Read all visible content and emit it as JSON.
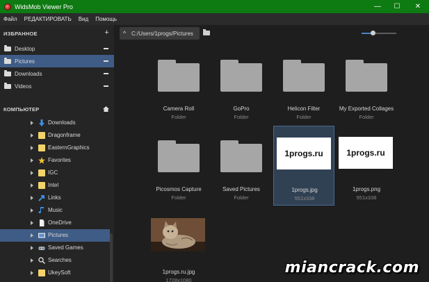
{
  "window": {
    "title": "WidsMob Viewer Pro",
    "minimize": "—",
    "maximize": "☐",
    "close": "✕"
  },
  "menu": [
    "Файл",
    "РЕДАКТИРОВАТЬ",
    "Вид",
    "Помощь"
  ],
  "sidebar": {
    "favorites_header": "ИЗБРАННОЕ",
    "favorites_add": "+",
    "favorites": [
      {
        "label": "Desktop",
        "selected": false
      },
      {
        "label": "Pictures",
        "selected": true
      },
      {
        "label": "Downloads",
        "selected": false
      },
      {
        "label": "Videos",
        "selected": false
      }
    ],
    "computer_header": "КОМПЬЮТЕР",
    "tree": [
      {
        "label": "Downloads",
        "icon": "download-arrow-icon"
      },
      {
        "label": "Dragonframe",
        "icon": "folder-icon"
      },
      {
        "label": "EasternGraphics",
        "icon": "folder-icon"
      },
      {
        "label": "Favorites",
        "icon": "star-icon"
      },
      {
        "label": "IGC",
        "icon": "folder-icon"
      },
      {
        "label": "Intel",
        "icon": "folder-icon"
      },
      {
        "label": "Links",
        "icon": "link-arrow-icon"
      },
      {
        "label": "Music",
        "icon": "music-note-icon"
      },
      {
        "label": "OneDrive",
        "icon": "document-icon"
      },
      {
        "label": "Pictures",
        "icon": "pictures-icon",
        "selected": true
      },
      {
        "label": "Saved Games",
        "icon": "saved-games-icon"
      },
      {
        "label": "Searches",
        "icon": "search-icon"
      },
      {
        "label": "UkeySoft",
        "icon": "folder-icon"
      }
    ]
  },
  "toolbar": {
    "up_glyph": "^",
    "path": "C:/Users/1progs/Pictures",
    "zoom_level": 0.32
  },
  "items": [
    {
      "name": "Camera Roll",
      "sub": "Folder",
      "kind": "folder"
    },
    {
      "name": "GoPro",
      "sub": "Folder",
      "kind": "folder"
    },
    {
      "name": "Helicon Filter",
      "sub": "Folder",
      "kind": "folder"
    },
    {
      "name": "My Exported Collages",
      "sub": "Folder",
      "kind": "folder"
    },
    {
      "name": "Picosmos Capture",
      "sub": "Folder",
      "kind": "folder"
    },
    {
      "name": "Saved Pictures",
      "sub": "Folder",
      "kind": "folder"
    },
    {
      "name": "1progs.jpg",
      "sub": "551x338",
      "kind": "image",
      "thumb_text": "1progs.ru",
      "selected": true
    },
    {
      "name": "1progs.png",
      "sub": "551x338",
      "kind": "image",
      "thumb_text": "1progs.ru"
    },
    {
      "name": "1progs.ru.jpg",
      "sub": "1728x1080",
      "kind": "photo"
    }
  ],
  "watermark": "miancrack.com",
  "colors": {
    "titlebar": "#0e7a12",
    "selection": "#3f5c86",
    "tile_selection": "#314154"
  }
}
